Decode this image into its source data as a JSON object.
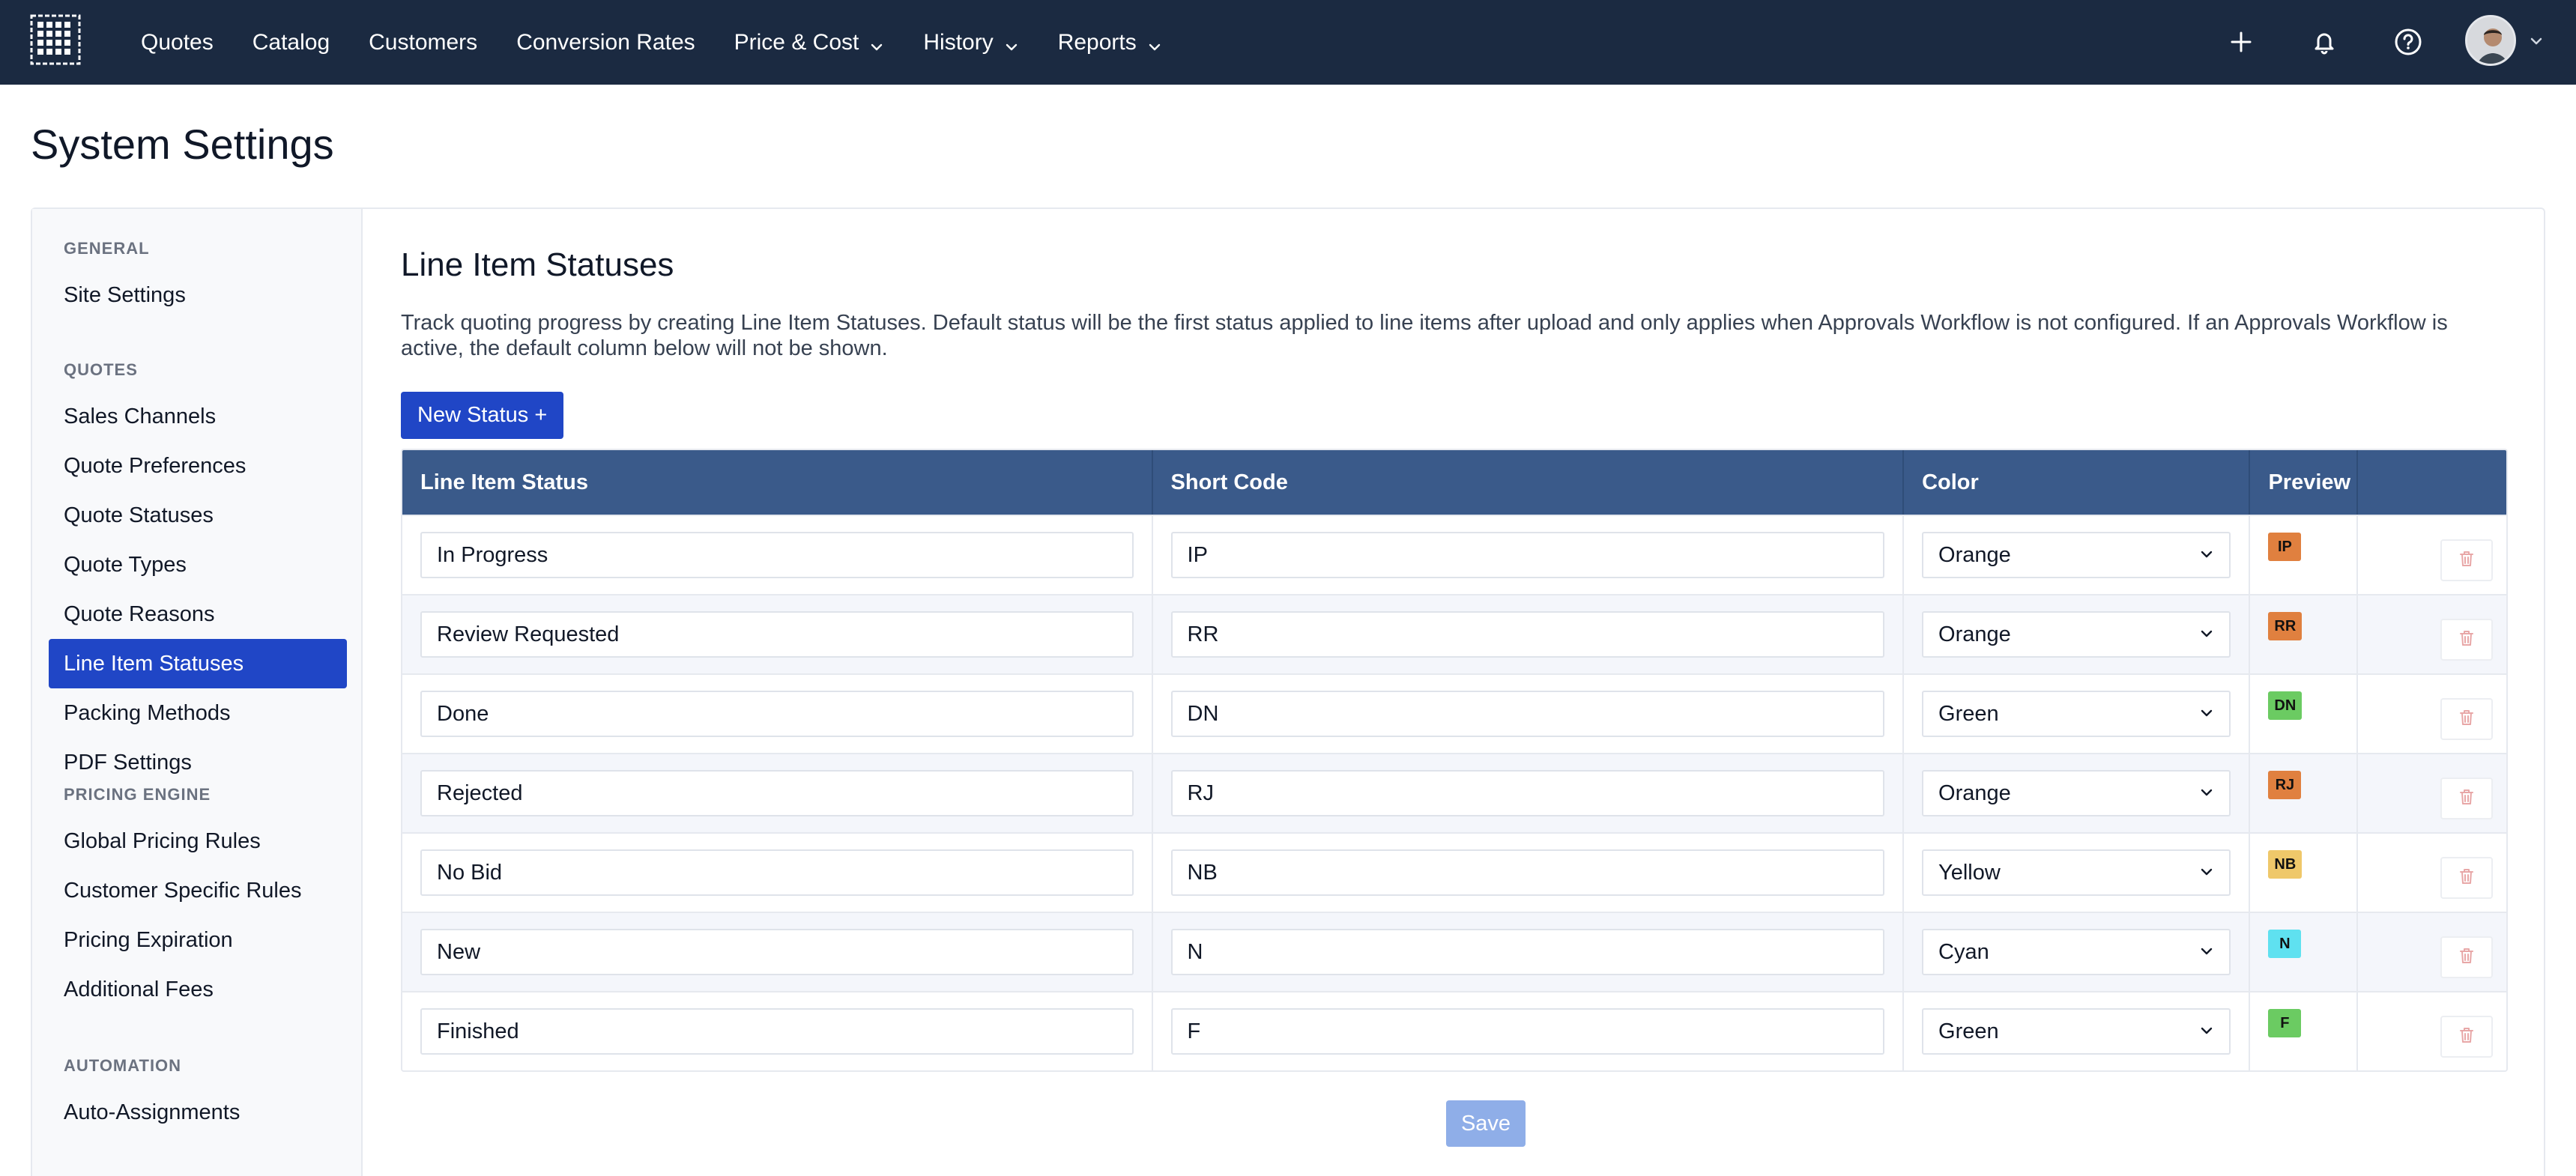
{
  "nav": {
    "items": [
      {
        "label": "Quotes",
        "dropdown": false
      },
      {
        "label": "Catalog",
        "dropdown": false
      },
      {
        "label": "Customers",
        "dropdown": false
      },
      {
        "label": "Conversion Rates",
        "dropdown": false
      },
      {
        "label": "Price & Cost",
        "dropdown": true
      },
      {
        "label": "History",
        "dropdown": true
      },
      {
        "label": "Reports",
        "dropdown": true
      }
    ],
    "icons": [
      "plus-icon",
      "bell-icon",
      "help-icon",
      "avatar",
      "chevron-down-icon"
    ]
  },
  "page": {
    "title": "System Settings"
  },
  "sidebar": {
    "sections": [
      {
        "title": "GENERAL",
        "items": [
          "Site Settings"
        ]
      },
      {
        "title": "QUOTES",
        "items": [
          "Sales Channels",
          "Quote Preferences",
          "Quote Statuses",
          "Quote Types",
          "Quote Reasons",
          "Line Item Statuses",
          "Packing Methods",
          "PDF Settings"
        ]
      },
      {
        "title": "PRICING ENGINE",
        "items": [
          "Global Pricing Rules",
          "Customer Specific Rules",
          "Pricing Expiration",
          "Additional Fees"
        ]
      },
      {
        "title": "AUTOMATION",
        "items": [
          "Auto-Assignments"
        ]
      }
    ],
    "active": "Line Item Statuses"
  },
  "main": {
    "title": "Line Item Statuses",
    "description": "Track quoting progress by creating Line Item Statuses. Default status will be the first status applied to line items after upload and only applies when Approvals Workflow is not configured. If an Approvals Workflow is active, the default column below will not be shown.",
    "new_button": "New Status +",
    "save_button": "Save",
    "columns": [
      "Line Item Status",
      "Short Code",
      "Color",
      "Preview",
      ""
    ],
    "rows": [
      {
        "status": "In Progress",
        "code": "IP",
        "color": "Orange",
        "swatch": "#e0803f"
      },
      {
        "status": "Review Requested",
        "code": "RR",
        "color": "Orange",
        "swatch": "#e0803f"
      },
      {
        "status": "Done",
        "code": "DN",
        "color": "Green",
        "swatch": "#6bcb62"
      },
      {
        "status": "Rejected",
        "code": "RJ",
        "color": "Orange",
        "swatch": "#e0803f"
      },
      {
        "status": "No Bid",
        "code": "NB",
        "color": "Yellow",
        "swatch": "#efc86a"
      },
      {
        "status": "New",
        "code": "N",
        "color": "Cyan",
        "swatch": "#5fe1f0"
      },
      {
        "status": "Finished",
        "code": "F",
        "color": "Green",
        "swatch": "#6bcb62"
      }
    ]
  },
  "colors": {
    "nav_bg": "#1b2a41",
    "accent": "#2046c6",
    "table_header": "#3a5a8a",
    "delete_icon": "#e8a7a7"
  }
}
